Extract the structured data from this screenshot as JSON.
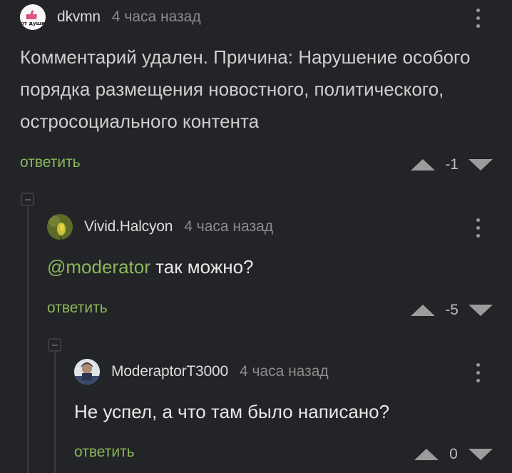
{
  "comments": [
    {
      "author": "dkvmn",
      "time": "4 часа назад",
      "text": "Комментарий удален. Причина: Нарушение особого порядка размещения новостного, политического, остросоциального контента",
      "reply_label": "ответить",
      "score": "-1",
      "avatar_text": "от души"
    },
    {
      "author": "Vivid.Halcyon",
      "time": "4 часа назад",
      "mention": "@moderator",
      "text": " так можно?",
      "reply_label": "ответить",
      "score": "-5"
    },
    {
      "author": "ModeraptorT3000",
      "time": "4 часа назад",
      "text": "Не успел, а что там было написано?",
      "reply_label": "ответить",
      "score": "0"
    }
  ],
  "colors": {
    "background": "#232427",
    "accent_green": "#8ab85a",
    "muted_text": "#8c8c8c"
  }
}
